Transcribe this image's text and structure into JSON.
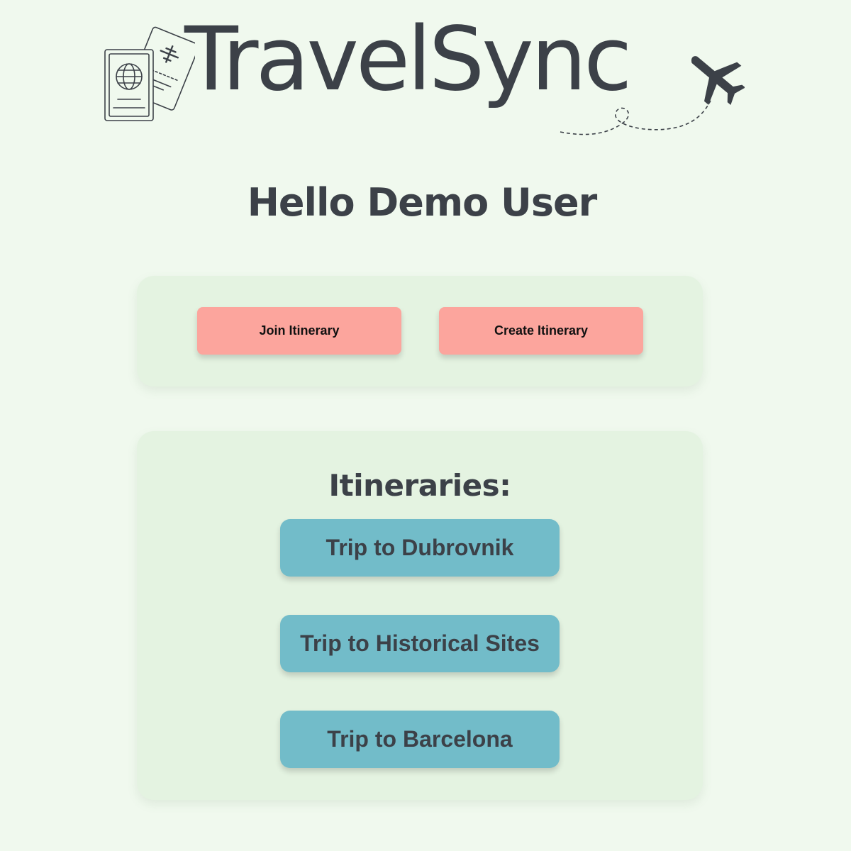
{
  "app": {
    "logo_text": "TravelSync"
  },
  "greeting": "Hello Demo User",
  "actions": {
    "join_label": "Join Itinerary",
    "create_label": "Create Itinerary"
  },
  "itineraries": {
    "title": "Itineraries:",
    "items": [
      {
        "label": "Trip to Dubrovnik"
      },
      {
        "label": "Trip to Historical Sites"
      },
      {
        "label": "Trip to Barcelona"
      }
    ]
  },
  "icons": {
    "logo_left": "passport-ticket-icon",
    "logo_right": "airplane-icon"
  },
  "colors": {
    "background": "#f0f9ee",
    "card": "#e4f3e1",
    "action_button": "#fca59d",
    "trip_button": "#72bcc9",
    "text": "#3c4148"
  }
}
